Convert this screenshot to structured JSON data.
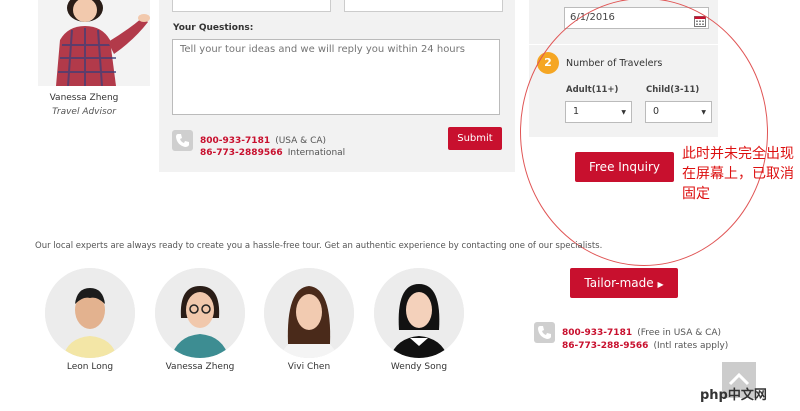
{
  "advisor": {
    "name": "Vanessa Zheng",
    "role": "Travel Advisor"
  },
  "form": {
    "questions_label": "Your Questions:",
    "questions_placeholder": "Tell your tour ideas and we will reply you within 24 hours",
    "phone_us": "800-933-7181",
    "phone_us_note": "(USA & CA)",
    "phone_intl": "86-773-2889566",
    "phone_intl_note": "International",
    "submit_label": "Submit"
  },
  "inquiry": {
    "date_value": "6/1/2016",
    "step_number": "2",
    "travelers_label": "Number of Travelers",
    "adult_label": "Adult(11+)",
    "adult_value": "1",
    "child_label": "Child(3-11)",
    "child_value": "0",
    "button_label": "Free Inquiry"
  },
  "annotation": {
    "text": "此时并未完全出现在屏幕上，已取消固定",
    "color": "#dd1111"
  },
  "experts": {
    "intro": "Our local experts are always ready to create you a hassle-free tour. Get an authentic experience by contacting one of our specialists.",
    "people": [
      {
        "name": "Leon Long"
      },
      {
        "name": "Vanessa Zheng"
      },
      {
        "name": "Vivi Chen"
      },
      {
        "name": "Wendy Song"
      }
    ]
  },
  "tailor": {
    "button_label": "Tailor-made",
    "phone_us": "800-933-7181",
    "phone_us_note": "(Free in USA & CA)",
    "phone_intl": "86-773-288-9566",
    "phone_intl_note": "(Intl rates apply)"
  },
  "watermark": {
    "text": "php中文网"
  },
  "colors": {
    "brand_red": "#c8102e",
    "badge_orange": "#f5a623",
    "panel_gray": "#f2f2f2"
  }
}
